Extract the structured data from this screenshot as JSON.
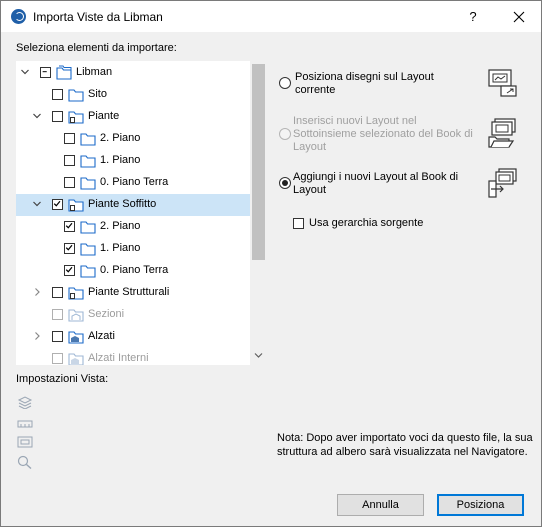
{
  "window": {
    "title": "Importa Viste da Libman",
    "help": "?"
  },
  "select_label": "Seleziona elementi da importare:",
  "tree": [
    {
      "label": "Libman",
      "expander": "expanded",
      "check": "partial",
      "icon": "folder-set-icon",
      "disabled": false
    },
    {
      "label": "Sito",
      "expander": "",
      "check": "unchecked",
      "icon": "folder-icon",
      "disabled": false
    },
    {
      "label": "Piante",
      "expander": "expanded",
      "check": "unchecked",
      "icon": "plan-folder-icon",
      "disabled": false
    },
    {
      "label": "2. Piano",
      "expander": "",
      "check": "unchecked",
      "icon": "folder-icon",
      "disabled": false
    },
    {
      "label": "1. Piano",
      "expander": "",
      "check": "unchecked",
      "icon": "folder-icon",
      "disabled": false
    },
    {
      "label": "0. Piano Terra",
      "expander": "",
      "check": "unchecked",
      "icon": "folder-icon",
      "disabled": false
    },
    {
      "label": "Piante Soffitto",
      "expander": "expanded",
      "check": "checked",
      "icon": "plan-folder-icon",
      "disabled": false,
      "selected": true
    },
    {
      "label": "2. Piano",
      "expander": "",
      "check": "checked",
      "icon": "folder-icon",
      "disabled": false
    },
    {
      "label": "1. Piano",
      "expander": "",
      "check": "checked",
      "icon": "folder-icon",
      "disabled": false
    },
    {
      "label": "0. Piano Terra",
      "expander": "",
      "check": "checked",
      "icon": "folder-icon",
      "disabled": false
    },
    {
      "label": "Piante Strutturali",
      "expander": "collapsed",
      "check": "unchecked",
      "icon": "plan-folder-icon",
      "disabled": false
    },
    {
      "label": "Sezioni",
      "expander": "",
      "check": "unchecked",
      "icon": "section-folder-icon",
      "disabled": true
    },
    {
      "label": "Alzati",
      "expander": "collapsed",
      "check": "unchecked",
      "icon": "elevation-folder-icon",
      "disabled": false
    },
    {
      "label": "Alzati Interni",
      "expander": "",
      "check": "unchecked",
      "icon": "elevation-folder-icon",
      "disabled": true
    }
  ],
  "options": {
    "place_current": "Posiziona disegni sul Layout corrente",
    "insert_subset": "Inserisci nuovi Layout nel Sottoinsieme selezionato del Book di Layout",
    "add_book": "Aggiungi i nuovi Layout al Book di Layout",
    "use_hierarchy": "Usa gerarchia sorgente",
    "selected": "add_book"
  },
  "view_settings_label": "Impostazioni Vista:",
  "view_setting_icons": [
    "layers-icon",
    "dimension-icon",
    "frame-icon",
    "zoom-icon"
  ],
  "note": "Nota: Dopo aver importato voci da questo file, la sua struttura ad albero sarà visualizzata nel Navigatore.",
  "buttons": {
    "cancel": "Annulla",
    "place": "Posiziona"
  },
  "colors": {
    "selection": "#cce4f7",
    "accent": "#0078d7",
    "folder_icon": "#1b6ac9"
  }
}
